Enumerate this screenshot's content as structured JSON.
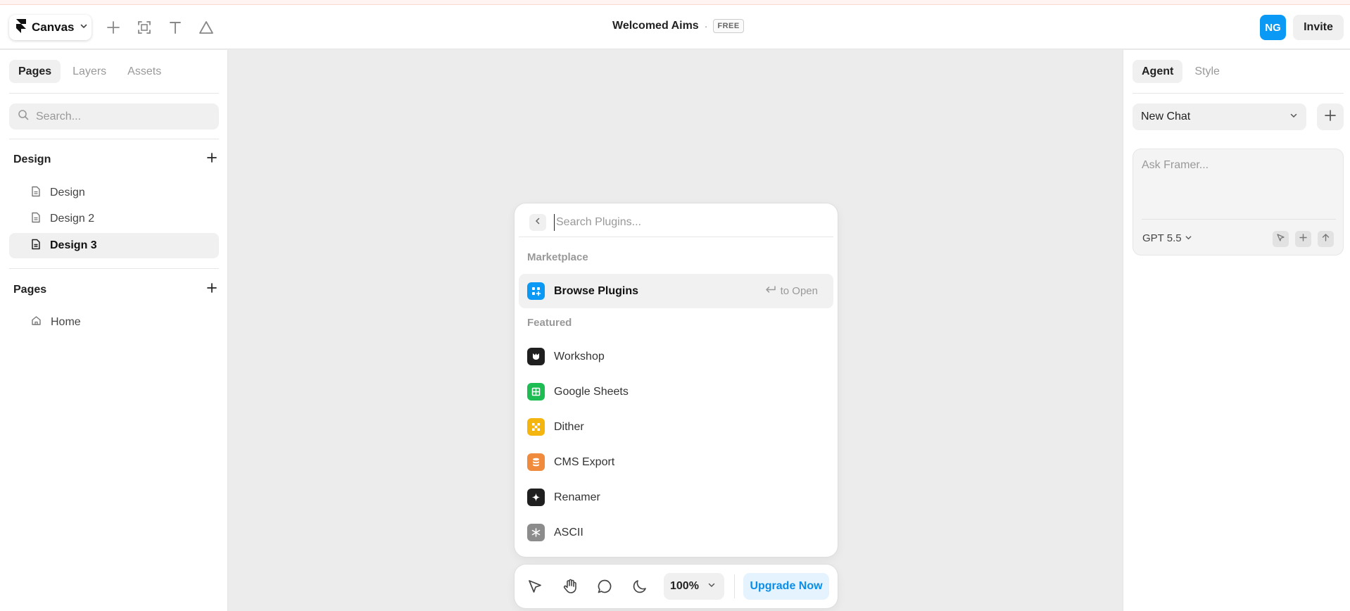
{
  "topbar": {
    "app_menu_label": "Canvas",
    "project_title": "Welcomed Aims",
    "separator": "·",
    "plan_badge": "FREE",
    "avatar_initials": "NG",
    "invite_label": "Invite",
    "tools": [
      "plus-icon",
      "frame-icon",
      "text-icon",
      "triangle-icon"
    ]
  },
  "left_panel": {
    "tabs": [
      {
        "label": "Pages",
        "active": true
      },
      {
        "label": "Layers",
        "active": false
      },
      {
        "label": "Assets",
        "active": false
      }
    ],
    "search_placeholder": "Search...",
    "sections": [
      {
        "title": "Design",
        "items": [
          {
            "label": "Design",
            "icon": "page-icon",
            "selected": false
          },
          {
            "label": "Design 2",
            "icon": "page-icon",
            "selected": false
          },
          {
            "label": "Design 3",
            "icon": "page-icon",
            "selected": true
          }
        ]
      },
      {
        "title": "Pages",
        "items": [
          {
            "label": "Home",
            "icon": "home-icon",
            "selected": false
          }
        ]
      }
    ]
  },
  "right_panel": {
    "tabs": [
      {
        "label": "Agent",
        "active": true
      },
      {
        "label": "Style",
        "active": false
      }
    ],
    "chat_select_value": "New Chat",
    "ask_placeholder": "Ask Framer...",
    "model_label": "GPT 5.5"
  },
  "plugin_popup": {
    "search_placeholder": "Search Plugins...",
    "marketplace_label": "Marketplace",
    "browse": {
      "label": "Browse Plugins",
      "hint": "to Open",
      "icon_color": "#0a9af5"
    },
    "featured_label": "Featured",
    "featured": [
      {
        "label": "Workshop",
        "icon": "workshop-icon",
        "color": "#1f1f1f"
      },
      {
        "label": "Google Sheets",
        "icon": "sheets-icon",
        "color": "#1ebd53"
      },
      {
        "label": "Dither",
        "icon": "dither-icon",
        "color": "#f5b50f"
      },
      {
        "label": "CMS Export",
        "icon": "database-icon",
        "color": "#f08a3c"
      },
      {
        "label": "Renamer",
        "icon": "sparkle-icon",
        "color": "#1f1f1f"
      },
      {
        "label": "ASCII",
        "icon": "asterisk-icon",
        "color": "#8c8c8c"
      }
    ]
  },
  "bottom_bar": {
    "tools": [
      "pointer-icon",
      "hand-icon",
      "comment-icon",
      "moon-icon"
    ],
    "zoom": "100%",
    "upgrade_label": "Upgrade Now"
  },
  "colors": {
    "accent": "#0a9af5",
    "canvas_bg": "#ececec",
    "upgrade_bg": "#e4f3fe"
  }
}
